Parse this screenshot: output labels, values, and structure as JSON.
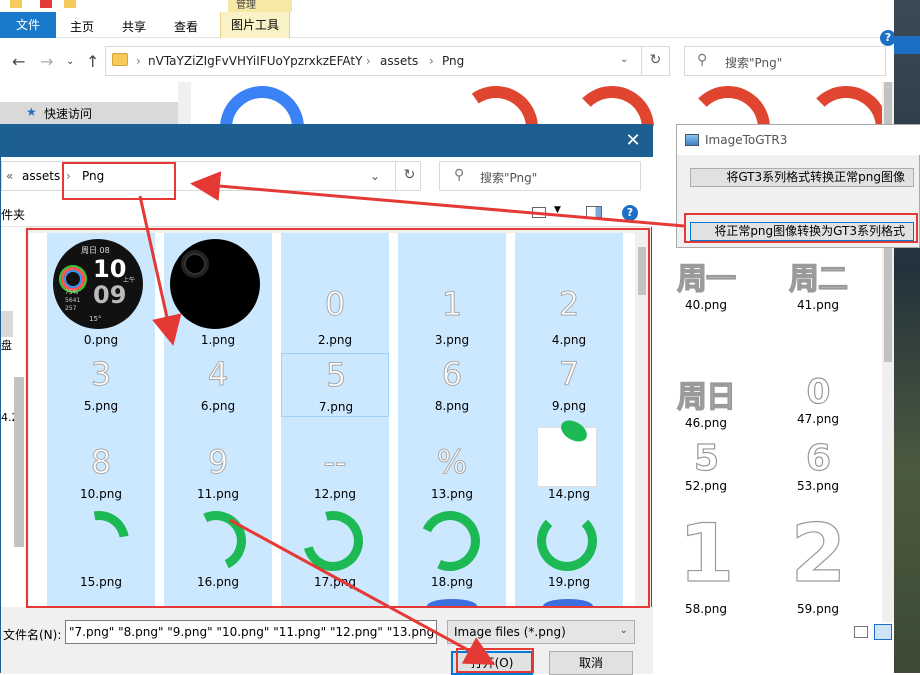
{
  "explorer": {
    "tabs": {
      "file": "文件",
      "home": "主页",
      "share": "共享",
      "view": "查看",
      "picture_tools": "图片工具",
      "manage": "管理"
    },
    "crumbs": [
      "nVTaYZiZIgFvVHYiIFUoYpzrxkzEFAtY",
      "assets",
      "Png"
    ],
    "search_placeholder": "搜索\"Png\"",
    "quick_access": "快速访问",
    "thumbs": [
      {
        "label": "40.png",
        "glyph": "周一"
      },
      {
        "label": "41.png",
        "glyph": "周二"
      },
      {
        "label": "46.png",
        "glyph": "周日"
      },
      {
        "label": "47.png",
        "glyph": "0"
      },
      {
        "label": "52.png",
        "glyph": "5"
      },
      {
        "label": "53.png",
        "glyph": "6"
      },
      {
        "label": "58.png",
        "glyph": "1"
      },
      {
        "label": "59.png",
        "glyph": "2"
      }
    ]
  },
  "gtr3": {
    "title": "ImageToGTR3",
    "btn_to_png": "将GT3系列格式转换正常png图像",
    "btn_to_gt3": "将正常png图像转换为GT3系列格式"
  },
  "dialog": {
    "breadcrumb": {
      "prefix": "«",
      "parent": "assets",
      "current": "Png"
    },
    "search_placeholder": "搜索\"Png\"",
    "toolbar_left": "件夹",
    "left_texts": [
      "盘",
      "4.2"
    ],
    "watch_face": {
      "date": "周日 08",
      "hour": "10",
      "minute": "09",
      "ampm": "上午",
      "stats": [
        "75%",
        "5641",
        "257"
      ],
      "temp": "15°"
    },
    "files": [
      {
        "label": "0.png"
      },
      {
        "label": "1.png"
      },
      {
        "label": "2.png",
        "glyph": "0"
      },
      {
        "label": "3.png",
        "glyph": "1"
      },
      {
        "label": "4.png",
        "glyph": "2"
      },
      {
        "label": "5.png",
        "glyph": "3"
      },
      {
        "label": "6.png",
        "glyph": "4"
      },
      {
        "label": "7.png",
        "glyph": "5"
      },
      {
        "label": "8.png",
        "glyph": "6"
      },
      {
        "label": "9.png",
        "glyph": "7"
      },
      {
        "label": "10.png",
        "glyph": "8"
      },
      {
        "label": "11.png",
        "glyph": "9"
      },
      {
        "label": "12.png",
        "glyph": "--"
      },
      {
        "label": "13.png",
        "glyph": "%"
      },
      {
        "label": "14.png"
      },
      {
        "label": "15.png"
      },
      {
        "label": "16.png"
      },
      {
        "label": "17.png"
      },
      {
        "label": "18.png"
      },
      {
        "label": "19.png"
      }
    ],
    "filename_label": "文件名(N):",
    "filename_value": "\"7.png\" \"8.png\" \"9.png\" \"10.png\" \"11.png\" \"12.png\" \"13.png",
    "filter": "Image files (*.png)",
    "open_button": "打开(O)",
    "cancel_button": "取消"
  },
  "colors": {
    "accent": "#1d5f91",
    "selection": "#cce8ff",
    "ring_green": "#1db954",
    "ring_red": "#e0462f",
    "annotation_red": "#e53935"
  }
}
